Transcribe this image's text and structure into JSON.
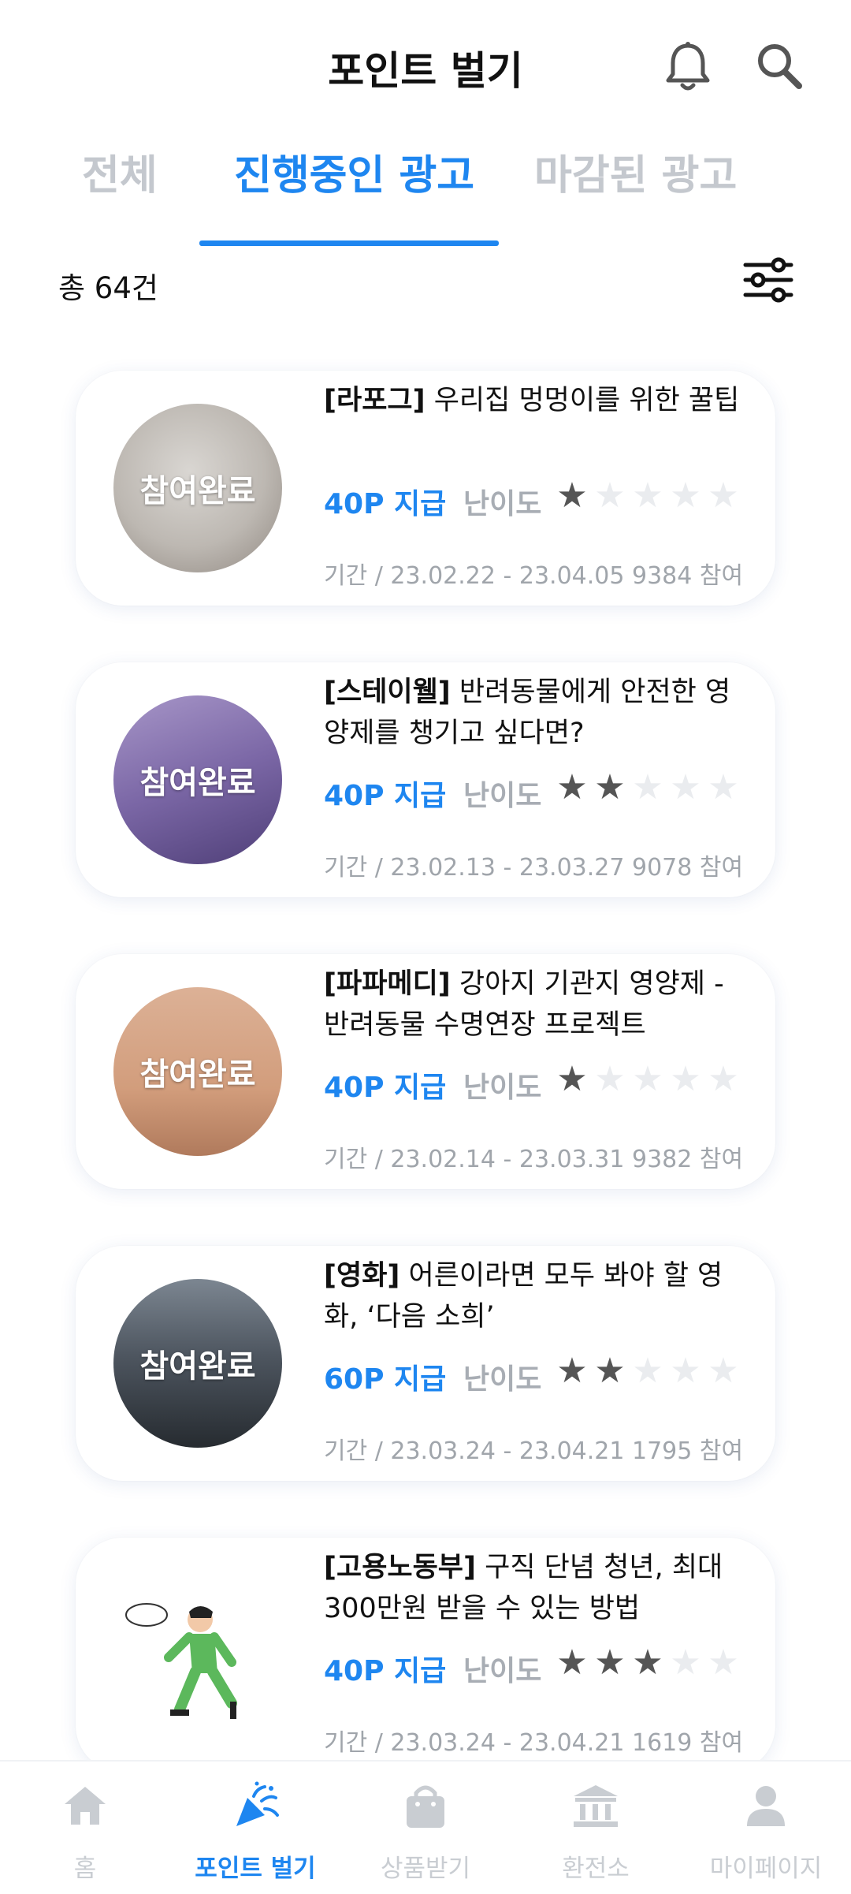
{
  "header": {
    "title": "포인트 벌기"
  },
  "tabs": [
    {
      "label": "전체"
    },
    {
      "label": "진행중인 광고"
    },
    {
      "label": "마감된 광고"
    }
  ],
  "list_meta": {
    "count_text": "총 64건"
  },
  "cards": [
    {
      "brand": "[라포그]",
      "title": " 우리집 멍멍이를 위한 꿀팁",
      "status": "참여완료",
      "point": "40P 지급",
      "difficulty_label": "난이도",
      "difficulty": 1,
      "max_difficulty": 5,
      "period": "기간 /  23.02.22 - 23.04.05 9384 참여",
      "thumb_colors": [
        "#c8c4bf",
        "#8f8780"
      ]
    },
    {
      "brand": "[스테이웰]",
      "title": " 반려동물에게 안전한 영양제를 챙기고 싶다면?",
      "status": "참여완료",
      "point": "40P 지급",
      "difficulty_label": "난이도",
      "difficulty": 2,
      "max_difficulty": 5,
      "period": "기간 /  23.02.13 - 23.03.27 9078 참여",
      "thumb_colors": [
        "#8e7bb2",
        "#4f3f78"
      ]
    },
    {
      "brand": "[파파메디]",
      "title": " 강아지 기관지 영양제 - 반려동물 수명연장 프로젝트",
      "status": "참여완료",
      "point": "40P 지급",
      "difficulty_label": "난이도",
      "difficulty": 1,
      "max_difficulty": 5,
      "period": "기간 /  23.02.14 - 23.03.31 9382 참여",
      "thumb_colors": [
        "#d9a98a",
        "#b07a5c"
      ]
    },
    {
      "brand": "[영화]",
      "title": " 어른이라면 모두 봐야 할 영화, ‘다음 소희’",
      "status": "참여완료",
      "point": "60P 지급",
      "difficulty_label": "난이도",
      "difficulty": 2,
      "max_difficulty": 5,
      "period": "기간 /  23.03.24 - 23.04.21 1795 참여",
      "thumb_colors": [
        "#5a6470",
        "#262b30"
      ]
    },
    {
      "brand": "[고용노동부]",
      "title": " 구직 단념 청년, 최대 300만원 받을 수 있는 방법",
      "status": "",
      "point": "40P 지급",
      "difficulty_label": "난이도",
      "difficulty": 3,
      "max_difficulty": 5,
      "period": "기간 /  23.03.24 - 23.04.21 1619 참여",
      "thumb_colors": [
        "#ffffff",
        "#ffffff"
      ]
    }
  ],
  "bottom_nav": [
    {
      "label": "홈",
      "icon": "home-icon"
    },
    {
      "label": "포인트 벌기",
      "icon": "party-popper-icon"
    },
    {
      "label": "상품받기",
      "icon": "shopping-bag-icon"
    },
    {
      "label": "환전소",
      "icon": "bank-icon"
    },
    {
      "label": "마이페이지",
      "icon": "person-icon"
    }
  ],
  "colors": {
    "accent": "#1e86f0",
    "inactive": "#c4c8ce"
  }
}
